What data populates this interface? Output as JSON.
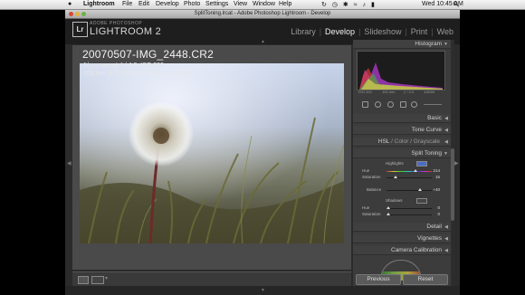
{
  "menubar": {
    "apple_glyph": "",
    "app_name": "Lightroom",
    "items": [
      "File",
      "Edit",
      "Develop",
      "Photo",
      "Settings",
      "View",
      "Window",
      "Help"
    ],
    "clock": "Wed 10:45 AM"
  },
  "window": {
    "title": "SplitToning.lrcat - Adobe Photoshop Lightroom - Develop"
  },
  "identity": {
    "badge": "Lr",
    "adobe": "ADOBE PHOTOSHOP",
    "product": "LIGHTROOM 2"
  },
  "modules": {
    "items": [
      "Library",
      "Develop",
      "Slideshow",
      "Print",
      "Web"
    ],
    "active": "Develop"
  },
  "photo": {
    "filename": "20070507-IMG_2448.CR2",
    "exposure": "1/₆₀₀₀ sec at ƒ / 4.0, ISO 200",
    "lens": "100 mm (EF100mm f/2.8 Macro USM)"
  },
  "panels": {
    "histogram": "Histogram",
    "histo_info": [
      "ISO 200",
      "100 mm",
      "ƒ / 4.0",
      "1/6000"
    ],
    "basic": "Basic",
    "tone_curve": "Tone Curve",
    "hsl": "HSL",
    "color": "Color",
    "grayscale": "Grayscale",
    "hsl_sep": "/",
    "split_toning": "Split Toning",
    "detail": "Detail",
    "vignettes": "Vignettes",
    "camera_calibration": "Camera Calibration"
  },
  "split_toning": {
    "highlights_label": "Highlights",
    "hue_label": "Hue",
    "hue_value": "214",
    "saturation_label": "Saturation",
    "saturation_value": "16",
    "balance_label": "Balance",
    "balance_value": "+40",
    "shadows_label": "Shadows",
    "shadow_hue_label": "Hue",
    "shadow_hue_value": "0",
    "shadow_saturation_label": "Saturation",
    "shadow_saturation_value": "0",
    "highlight_color": "#4a6cc8"
  },
  "buttons": {
    "previous": "Previous",
    "reset": "Reset"
  },
  "colors": {
    "panel_bg": "#3c3c3c",
    "active_module": "#f2f2f2"
  }
}
